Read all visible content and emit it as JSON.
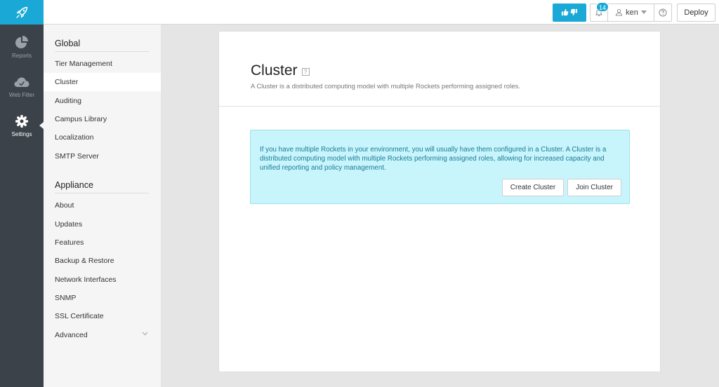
{
  "topbar": {
    "logo_icon": "rocket-icon",
    "feedback_icon": "thumbs-up-down-icon",
    "notifications_count": "14",
    "user_name": "ken",
    "help_icon": "question-icon",
    "deploy_label": "Deploy"
  },
  "rail": {
    "items": [
      {
        "label": "Reports",
        "icon": "pie-chart-icon"
      },
      {
        "label": "Web Filter",
        "icon": "cloud-icon"
      },
      {
        "label": "Settings",
        "icon": "gear-icon"
      }
    ]
  },
  "subnav": {
    "global_heading": "Global",
    "global_items": [
      "Tier Management",
      "Cluster",
      "Auditing",
      "Campus Library",
      "Localization",
      "SMTP Server"
    ],
    "appliance_heading": "Appliance",
    "appliance_items": [
      "About",
      "Updates",
      "Features",
      "Backup & Restore",
      "Network Interfaces",
      "SNMP",
      "SSL Certificate",
      "Advanced"
    ]
  },
  "main": {
    "title": "Cluster",
    "help_marker": "?",
    "subtitle": "A Cluster is a distributed computing model with multiple Rockets performing assigned roles.",
    "info_text": "If you have multiple Rockets in your environment, you will usually have them configured in a Cluster. A Cluster is a distributed computing model with multiple Rockets performing assigned roles, allowing for increased capacity and unified reporting and policy management.",
    "create_label": "Create Cluster",
    "join_label": "Join Cluster"
  },
  "colors": {
    "brand": "#1aa9d6",
    "rail_bg": "#3b4249",
    "info_bg": "#c7f5fb",
    "info_text": "#1b7a99"
  }
}
